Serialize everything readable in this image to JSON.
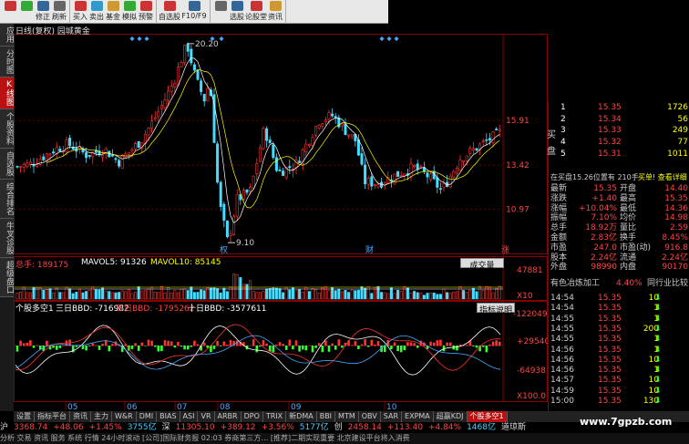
{
  "toolbar": {
    "groups": [
      [
        {
          "label": "",
          "color": "#c33"
        },
        {
          "label": "",
          "color": "#3a3"
        },
        {
          "label": "修正",
          "color": "#369"
        },
        {
          "label": "刷新",
          "color": "#666"
        }
      ],
      [
        {
          "label": "买入",
          "color": "#c33"
        },
        {
          "label": "卖出",
          "color": "#39c"
        },
        {
          "label": "基金",
          "color": "#c93"
        },
        {
          "label": "模拟",
          "color": "#3a3"
        },
        {
          "label": "预警",
          "color": "#c33"
        }
      ],
      [
        {
          "label": "自选股",
          "color": "#c33"
        },
        {
          "label": "F10/F9",
          "color": "#369"
        }
      ],
      [
        {
          "label": "",
          "color": "#666"
        },
        {
          "label": "选股",
          "color": "#369"
        },
        {
          "label": "论股堂",
          "color": "#c33"
        },
        {
          "label": "资讯",
          "color": "#c93"
        }
      ]
    ]
  },
  "left_tabs": [
    {
      "label": "应用",
      "active": false
    },
    {
      "label": "分时图",
      "active": false
    },
    {
      "label": "K线图",
      "active": true
    },
    {
      "label": "个股资料",
      "active": false
    },
    {
      "label": "自选股",
      "active": false
    },
    {
      "label": "综合排名",
      "active": false
    },
    {
      "label": "牛叉诊股",
      "active": false
    },
    {
      "label": "超级盘口",
      "active": false
    }
  ],
  "chart": {
    "header": "日线(复权)  园城黄金",
    "high_label": "20.20",
    "low_label": "9.10",
    "y_labels": [
      "15.91",
      "13.42",
      "10.97"
    ],
    "markers": [
      "权",
      "财",
      "涨"
    ],
    "volume_header": {
      "total": "总手: 189175",
      "ma5": "MAVOL5: 91326",
      "ma10": "MAVOL10: 85145"
    },
    "volume_button": "成交量",
    "volume_labels": [
      "47881",
      "X10"
    ],
    "bbd_header": {
      "name": "个股多空1",
      "bbd3": "三日BBD: -716982",
      "bbd5": "五日BBD: -1795262",
      "bbd10": "十日BBD: -3577611"
    },
    "bbd_button": "指标说明",
    "bbd_labels": [
      "-122049",
      "+29540",
      "-64938",
      "X100.0"
    ],
    "bbd_tag": "个股多空1",
    "months": [
      "05",
      "06",
      "07",
      "08",
      "09",
      "10"
    ]
  },
  "chart_data": {
    "type": "candlestick",
    "title": "日线(复权) 园城黄金",
    "high": 20.2,
    "low": 9.1,
    "y_ticks": [
      15.91,
      13.42,
      10.97
    ]
  },
  "right_panel": {
    "side_label_buy": "买盘",
    "orders": [
      {
        "idx": "1",
        "price": "15.35",
        "vol": "1726"
      },
      {
        "idx": "2",
        "price": "15.34",
        "vol": "56"
      },
      {
        "idx": "3",
        "price": "15.33",
        "vol": "249"
      },
      {
        "idx": "4",
        "price": "15.32",
        "vol": "77"
      },
      {
        "idx": "5",
        "price": "15.31",
        "vol": "1011"
      }
    ],
    "pending_info": "在买盘15.26位置有  210手",
    "pending_button": "买单!  查看详细",
    "quote": [
      {
        "l1": "最新",
        "v1": "15.35",
        "l2": "开盘",
        "v2": "14.40"
      },
      {
        "l1": "涨跌",
        "v1": "+1.40",
        "l2": "最高",
        "v2": "15.35"
      },
      {
        "l1": "涨幅",
        "v1": "+10.04%",
        "l2": "最低",
        "v2": "14.36"
      },
      {
        "l1": "振幅",
        "v1": "7.10%",
        "l2": "均价",
        "v2": "14.98"
      },
      {
        "l1": "总手",
        "v1": "18.92万",
        "l2": "量比",
        "v2": "2.59"
      },
      {
        "l1": "金额",
        "v1": "2.83亿",
        "l2": "换手",
        "v2": "8.45%"
      },
      {
        "l1": "市盈",
        "v1": "247.0",
        "l2": "市盈(动)",
        "v2": "916.8"
      },
      {
        "l1": "股本",
        "v1": "2.24亿",
        "l2": "流通",
        "v2": "2.24亿"
      },
      {
        "l1": "外盘",
        "v1": "98990",
        "l2": "内盘",
        "v2": "90170"
      }
    ],
    "sector_name": "有色冶炼加工",
    "sector_pct": "4.40%",
    "sector_button": "同行业比较",
    "ticks": [
      {
        "time": "14:54",
        "price": "15.35",
        "vol": "10"
      },
      {
        "time": "14:54",
        "price": "15.35",
        "vol": "1"
      },
      {
        "time": "14:55",
        "price": "15.35",
        "vol": "1"
      },
      {
        "time": "14:55",
        "price": "15.35",
        "vol": "200"
      },
      {
        "time": "14:55",
        "price": "15.35",
        "vol": "1"
      },
      {
        "time": "14:56",
        "price": "15.35",
        "vol": "1"
      },
      {
        "time": "14:56",
        "price": "15.35",
        "vol": "10"
      },
      {
        "time": "14:56",
        "price": "15.35",
        "vol": "1"
      },
      {
        "time": "14:57",
        "price": "15.35",
        "vol": "10"
      },
      {
        "time": "14:59",
        "price": "15.35",
        "vol": "10"
      },
      {
        "time": "15:00",
        "price": "15.35",
        "vol": "130"
      }
    ]
  },
  "bottom_tabs": [
    "设置",
    "指标平台",
    "资讯",
    "主力",
    "W&R",
    "DMI",
    "BIAS",
    "ASI",
    "VR",
    "ARBR",
    "DPO",
    "TRIX",
    "新DMA",
    "BBI",
    "MTM",
    "OBV",
    "SAR",
    "EXPMA",
    "超赢KDJ",
    "个股多空1"
  ],
  "status": [
    {
      "text": "沪",
      "color": "#ddd"
    },
    {
      "text": "3368.74",
      "color": "#f44"
    },
    {
      "text": "+48.06",
      "color": "#f44"
    },
    {
      "text": "+1.45%",
      "color": "#f44"
    },
    {
      "text": "3755亿",
      "color": "#4cf"
    },
    {
      "text": "深",
      "color": "#ddd"
    },
    {
      "text": "11305.10",
      "color": "#f44"
    },
    {
      "text": "+389.12",
      "color": "#f44"
    },
    {
      "text": "+3.56%",
      "color": "#f44"
    },
    {
      "text": "5177亿",
      "color": "#4cf"
    },
    {
      "text": "创",
      "color": "#ddd"
    },
    {
      "text": "2458.14",
      "color": "#f44"
    },
    {
      "text": "+113.40",
      "color": "#f44"
    },
    {
      "text": "+4.84%",
      "color": "#f44"
    },
    {
      "text": "1468亿",
      "color": "#4cf"
    },
    {
      "text": "道琼斯",
      "color": "#ddd"
    }
  ],
  "status2": "分析  交易  资讯  服务  系统  行情  24小时滚动  [公司]国际财务报  02:03 券商第三方…  [推荐]二期实现重要 北京建设平台将入消费",
  "watermark": "www.7gpzb.com"
}
